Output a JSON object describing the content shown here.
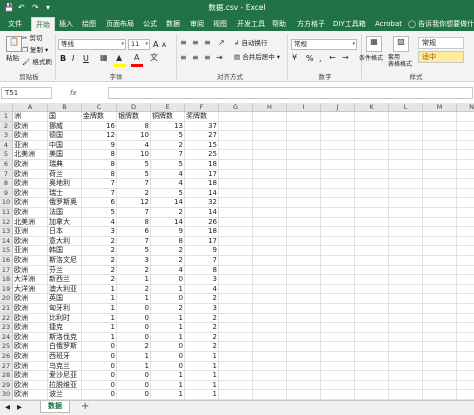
{
  "window": {
    "title": "数据.csv  -  Excel"
  },
  "quick_access": {
    "save_icon": "save-icon",
    "undo_icon": "undo-icon",
    "redo_icon": "redo-icon",
    "customize_icon": "chevron-down-icon"
  },
  "tabs": [
    "文件",
    "开始",
    "插入",
    "绘图",
    "页面布局",
    "公式",
    "数据",
    "审阅",
    "视图",
    "开发工具",
    "帮助",
    "方方格子",
    "DIY工具箱",
    "Acrobat"
  ],
  "active_tab": "开始",
  "tell_me": "告诉我你想要做什么",
  "ribbon": {
    "clipboard": {
      "paste": "粘贴",
      "cut": "剪切",
      "copy": "复制",
      "format_painter": "格式刷",
      "label": "剪贴板"
    },
    "font": {
      "name": "等线",
      "size": "11",
      "grow": "A",
      "shrink": "A",
      "bold": "B",
      "italic": "I",
      "underline": "U",
      "label": "字体",
      "font_color": "#ff0000",
      "fill_color": "#ffff00"
    },
    "alignment": {
      "wrap": "自动换行",
      "merge": "合并后居中",
      "label": "对齐方式"
    },
    "number": {
      "format": "常规",
      "percent": "%",
      "comma": ",",
      "label": "数字"
    },
    "styles": {
      "conditional": "条件格式",
      "table": "套用\n表格格式",
      "cell_styles": "单元格样式",
      "normal": "常规",
      "neutral": "适中",
      "label": "样式",
      "neutral_bg": "#ffeb9c",
      "neutral_fg": "#9c5700"
    }
  },
  "formula_bar": {
    "name_box": "T51",
    "fx": "fx",
    "value": ""
  },
  "columns": [
    "A",
    "B",
    "C",
    "D",
    "E",
    "F",
    "G",
    "H",
    "I",
    "J",
    "K",
    "L",
    "M",
    "N"
  ],
  "rows": [
    [
      "洲",
      "国",
      "金牌数",
      "银牌数",
      "铜牌数",
      "奖牌数"
    ],
    [
      "欧洲",
      "挪威",
      "16",
      "8",
      "13",
      "37"
    ],
    [
      "欧洲",
      "德国",
      "12",
      "10",
      "5",
      "27"
    ],
    [
      "亚洲",
      "中国",
      "9",
      "4",
      "2",
      "15"
    ],
    [
      "北美洲",
      "美国",
      "8",
      "10",
      "7",
      "25"
    ],
    [
      "欧洲",
      "瑞典",
      "8",
      "5",
      "5",
      "18"
    ],
    [
      "欧洲",
      "荷兰",
      "8",
      "5",
      "4",
      "17"
    ],
    [
      "欧洲",
      "奥地利",
      "7",
      "7",
      "4",
      "18"
    ],
    [
      "欧洲",
      "瑞士",
      "7",
      "2",
      "5",
      "14"
    ],
    [
      "欧洲",
      "俄罗斯奥",
      "6",
      "12",
      "14",
      "32"
    ],
    [
      "欧洲",
      "法国",
      "5",
      "7",
      "2",
      "14"
    ],
    [
      "北美洲",
      "加拿大",
      "4",
      "8",
      "14",
      "26"
    ],
    [
      "亚洲",
      "日本",
      "3",
      "6",
      "9",
      "18"
    ],
    [
      "欧洲",
      "意大利",
      "2",
      "7",
      "8",
      "17"
    ],
    [
      "亚洲",
      "韩国",
      "2",
      "5",
      "2",
      "9"
    ],
    [
      "欧洲",
      "斯洛文尼",
      "2",
      "3",
      "2",
      "7"
    ],
    [
      "欧洲",
      "芬兰",
      "2",
      "2",
      "4",
      "8"
    ],
    [
      "大洋洲",
      "新西兰",
      "2",
      "1",
      "0",
      "3"
    ],
    [
      "大洋洲",
      "澳大利亚",
      "1",
      "2",
      "1",
      "4"
    ],
    [
      "欧洲",
      "英国",
      "1",
      "1",
      "0",
      "2"
    ],
    [
      "欧洲",
      "匈牙利",
      "1",
      "0",
      "2",
      "3"
    ],
    [
      "欧洲",
      "比利时",
      "1",
      "0",
      "1",
      "2"
    ],
    [
      "欧洲",
      "捷克",
      "1",
      "0",
      "1",
      "2"
    ],
    [
      "欧洲",
      "斯洛伐克",
      "1",
      "0",
      "1",
      "2"
    ],
    [
      "欧洲",
      "白俄罗斯",
      "0",
      "2",
      "0",
      "2"
    ],
    [
      "欧洲",
      "西班牙",
      "0",
      "1",
      "0",
      "1"
    ],
    [
      "欧洲",
      "乌克兰",
      "0",
      "1",
      "0",
      "1"
    ],
    [
      "欧洲",
      "爱沙尼亚",
      "0",
      "0",
      "1",
      "1"
    ],
    [
      "欧洲",
      "拉脱维亚",
      "0",
      "0",
      "1",
      "1"
    ],
    [
      "欧洲",
      "波兰",
      "0",
      "0",
      "1",
      "1"
    ]
  ],
  "sheet": {
    "tab": "数据",
    "add": "+"
  }
}
